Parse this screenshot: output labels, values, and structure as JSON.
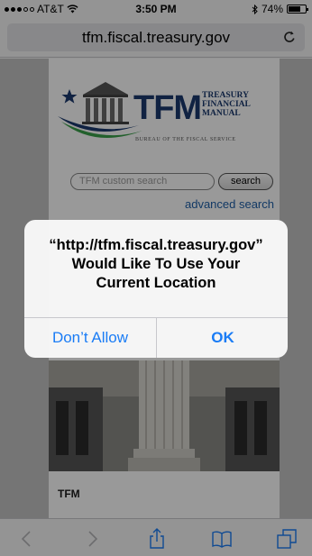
{
  "status_bar": {
    "carrier": "AT&T",
    "time": "3:50 PM",
    "battery_percent": "74%",
    "battery_level": 0.74,
    "bluetooth_icon": "bluetooth-icon",
    "wifi_icon": "wifi-icon"
  },
  "browser": {
    "url": "tfm.fiscal.treasury.gov",
    "reload_icon": "reload-icon"
  },
  "page": {
    "logo_abbr": "TFM",
    "logo_fullname": "TREASURY\nFINANCIAL\nMANUAL",
    "logo_bureau": "BUREAU OF THE FISCAL SERVICE",
    "search_placeholder": "TFM custom search",
    "search_button": "search",
    "advanced_search": "advanced search",
    "section_label": "TFM"
  },
  "alert": {
    "message_line1": "“http://tfm.fiscal.treasury.gov”",
    "message_line2": "Would Like To Use Your",
    "message_line3": "Current Location",
    "deny_label": "Don’t Allow",
    "allow_label": "OK"
  },
  "toolbar": {
    "back_icon": "back-icon",
    "forward_icon": "forward-icon",
    "share_icon": "share-icon",
    "bookmarks_icon": "bookmarks-icon",
    "tabs_icon": "tabs-icon"
  },
  "colors": {
    "ios_blue": "#1a7cf5",
    "tfm_navy": "#1b3a6e",
    "tfm_green": "#3aa04a",
    "link_blue": "#1f5fa8"
  }
}
